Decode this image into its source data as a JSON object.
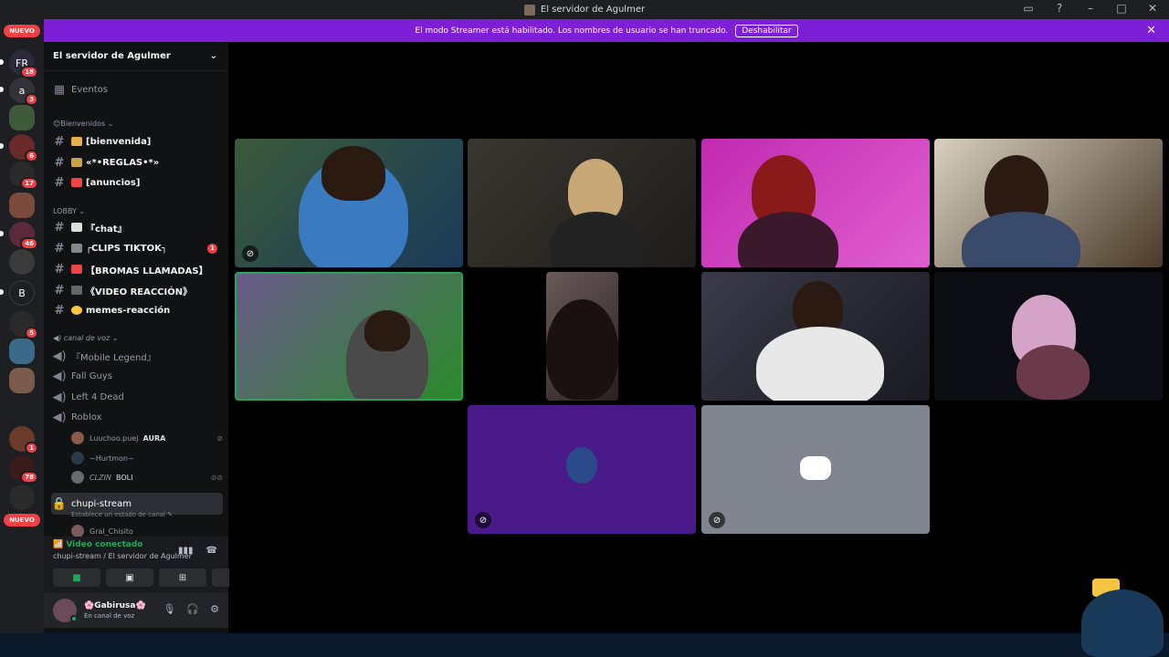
{
  "window": {
    "title": "El servidor de Agulmer"
  },
  "banner": {
    "text": "El modo Streamer está habilitado. Los nombres de usuario se han truncado.",
    "button": "Deshabilitar"
  },
  "servers": {
    "nuevo_top": "NUEVO",
    "nuevo_bottom": "NUEVO",
    "items": [
      {
        "label": "FR",
        "badge": "18"
      },
      {
        "label": "a",
        "badge": "3"
      },
      {
        "label": "",
        "badge": ""
      },
      {
        "label": "",
        "badge": "6"
      },
      {
        "label": "",
        "badge": "17"
      },
      {
        "label": "",
        "badge": ""
      },
      {
        "label": "",
        "badge": "46"
      },
      {
        "label": "",
        "badge": ""
      },
      {
        "label": "B",
        "badge": ""
      },
      {
        "label": "",
        "badge": "5"
      },
      {
        "label": "",
        "badge": ""
      },
      {
        "label": "",
        "badge": ""
      },
      {
        "label": "",
        "badge": ""
      },
      {
        "label": "",
        "badge": "1"
      },
      {
        "label": "",
        "badge": "78"
      },
      {
        "label": "",
        "badge": ""
      }
    ]
  },
  "sidebar": {
    "server_name": "El servidor de Agulmer",
    "events": "Eventos",
    "cat_welcome": "😊Bienvenidos",
    "cat_lobby": "LOBBY",
    "cat_voice": "canal de voz",
    "channels": {
      "bienvenida": "[bienvenida]",
      "reglas": "«*•REGLAS•*»",
      "anuncios": "[anuncios]",
      "chat": "『chat』",
      "clips": "┌CLIPS TIKTOK┐",
      "clips_badge": "1",
      "bromas": "【BROMAS LLAMADAS】",
      "video": "《VIDEO REACCIÓN》",
      "memes": "memes-reacción",
      "mobile": "『Mobile Legend』",
      "fallguys": "Fall Guys",
      "l4d": "Left 4 Dead",
      "roblox": "Roblox",
      "chupi": "chupi-stream",
      "chupi_status": "Establece un estado de canal"
    },
    "voice_users": [
      {
        "name": "Luuchoo.puej",
        "tag": "AURA"
      },
      {
        "name": "~Hurtmon~",
        "tag": ""
      },
      {
        "name": "CLZIN",
        "tag": "BOLI"
      }
    ],
    "chupi_user": "Gral_Chisito"
  },
  "voice_panel": {
    "status": "Video conectado",
    "channel": "chupi-stream / El servidor de Agulmer"
  },
  "user": {
    "name": "🌸Gabirusa🌸",
    "status": "En canal de voz"
  },
  "colors": {
    "accent": "#7c1fd6",
    "green": "#23a55a",
    "red": "#f23f43",
    "tile_purple": "#4a1a8a",
    "tile_gray": "#80848e"
  }
}
